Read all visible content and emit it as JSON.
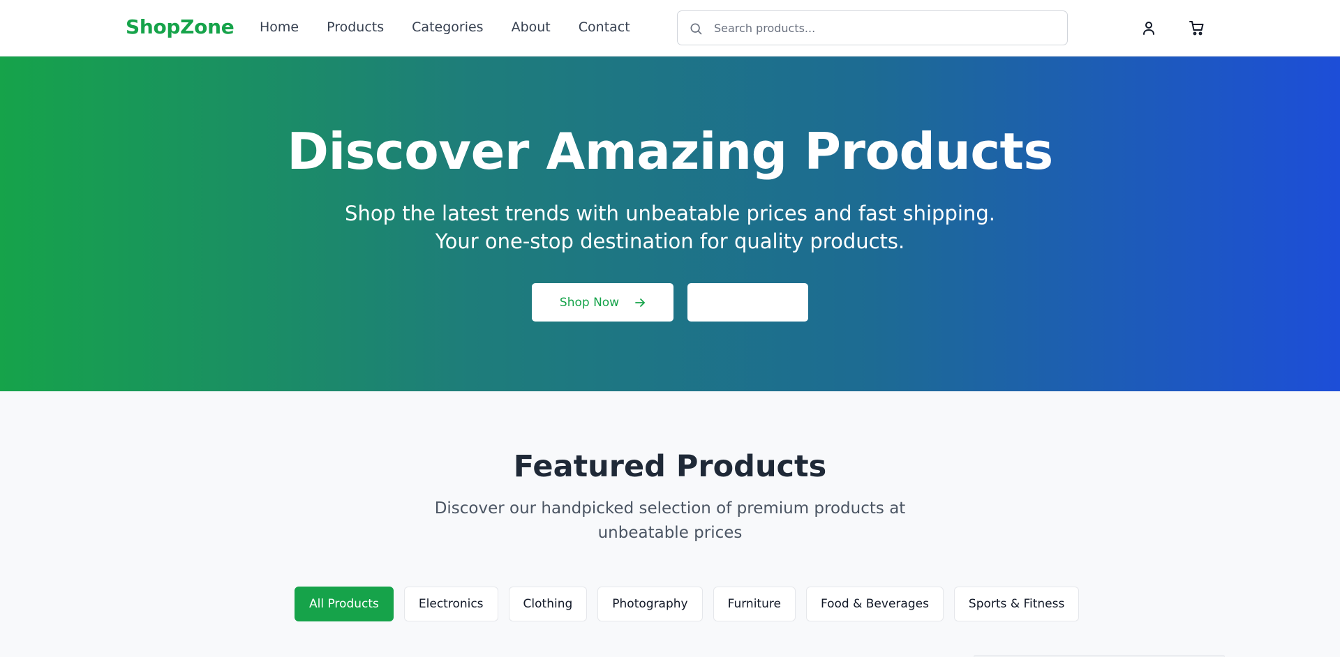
{
  "header": {
    "logo": "ShopZone",
    "nav": [
      "Home",
      "Products",
      "Categories",
      "About",
      "Contact"
    ],
    "search_placeholder": "Search products...",
    "icons": [
      "search-icon",
      "user-icon",
      "cart-icon"
    ]
  },
  "hero": {
    "title": "Discover Amazing Products",
    "subtitle": "Shop the latest trends with unbeatable prices and fast shipping. Your one-stop destination for quality products.",
    "primary_button": "Shop Now",
    "secondary_button": ""
  },
  "featured": {
    "title": "Featured Products",
    "subtitle": "Discover our handpicked selection of premium products at unbeatable prices",
    "filters": [
      "All Products",
      "Electronics",
      "Clothing",
      "Photography",
      "Furniture",
      "Food & Beverages",
      "Sports & Fitness"
    ],
    "active_filter": "All Products"
  },
  "colors": {
    "brand": "#16a34a",
    "hero_gradient_start": "#16a34a",
    "hero_gradient_end": "#1d4ed8",
    "text_dark": "#1f2937",
    "page_bg": "#f8f9fb"
  }
}
